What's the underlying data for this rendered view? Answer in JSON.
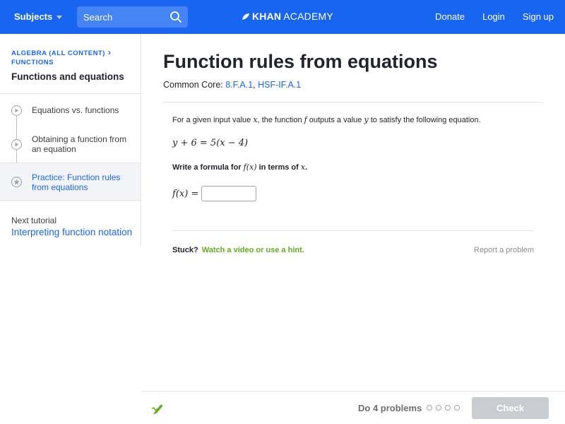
{
  "nav": {
    "subjects_label": "Subjects",
    "search_placeholder": "Search",
    "logo_khan": "KHAN",
    "logo_academy": "ACADEMY",
    "donate": "Donate",
    "login": "Login",
    "signup": "Sign up"
  },
  "sidebar": {
    "breadcrumb_top": "ALGEBRA (ALL CONTENT)",
    "breadcrumb_sub": "FUNCTIONS",
    "tutorial_title": "Functions and equations",
    "steps": [
      {
        "label": "Equations vs. functions",
        "icon": "play-icon"
      },
      {
        "label": "Obtaining a function from an equation",
        "icon": "play-icon"
      },
      {
        "label": "Practice: Function rules from equations",
        "icon": "star-icon"
      }
    ],
    "next_label": "Next tutorial",
    "next_link": "Interpreting function notation"
  },
  "main": {
    "title": "Function rules from equations",
    "common_core_label": "Common Core: ",
    "standard_1": "8.F.A.1",
    "standard_sep": ", ",
    "standard_2": "HSF-IF.A.1",
    "prompt_1": "For a given input value ",
    "var_x": "x",
    "prompt_2": ", the function ",
    "var_f": "f",
    "prompt_3": " outputs a value ",
    "var_y": "y",
    "prompt_4": " to satisfy the following equation.",
    "equation": "y + 6 = 5(x − 4)",
    "instruction_1": "Write a formula for ",
    "instruction_fx": "f(x)",
    "instruction_2": " in terms of ",
    "instruction_x": "x",
    "instruction_end": ".",
    "answer_label": "f(x) =",
    "answer_value": "",
    "stuck_label": "Stuck?",
    "stuck_link": "Watch a video or use a hint.",
    "report": "Report a problem"
  },
  "footer": {
    "do_problems": "Do 4 problems",
    "check_label": "Check"
  },
  "colors": {
    "brand_blue": "#1865f2",
    "hint_green": "#5fae1b",
    "check_disabled": "#c9ccd0"
  }
}
